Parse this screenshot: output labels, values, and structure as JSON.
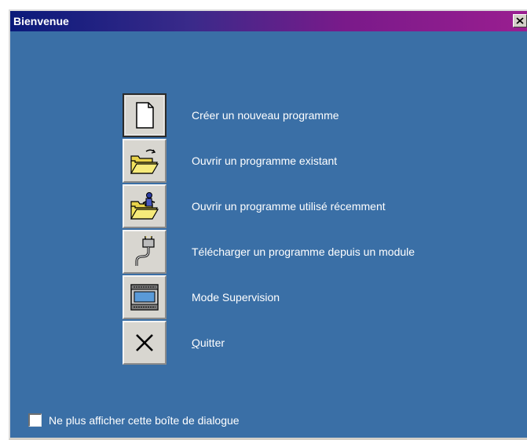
{
  "window": {
    "title": "Bienvenue",
    "colors": {
      "background": "#3a6fa6",
      "title_gradient_start": "#0a1a7a",
      "title_gradient_end": "#9a1e90",
      "button_face": "#d8d6d0"
    }
  },
  "menu": {
    "items": [
      {
        "label": "Créer un nouveau programme",
        "icon": "new-document-icon"
      },
      {
        "label": "Ouvrir un programme existant",
        "icon": "open-folder-icon"
      },
      {
        "label": "Ouvrir un programme utilisé récemment",
        "icon": "open-recent-folder-icon"
      },
      {
        "label": "Télécharger un programme depuis un module",
        "icon": "plug-icon"
      },
      {
        "label": "Mode Supervision",
        "icon": "monitor-module-icon"
      },
      {
        "label_underlined": "Q",
        "label_rest": "uitter",
        "icon": "close-x-icon"
      }
    ]
  },
  "footer": {
    "checkbox_label": "Ne plus afficher cette boîte de dialogue",
    "checked": false
  }
}
